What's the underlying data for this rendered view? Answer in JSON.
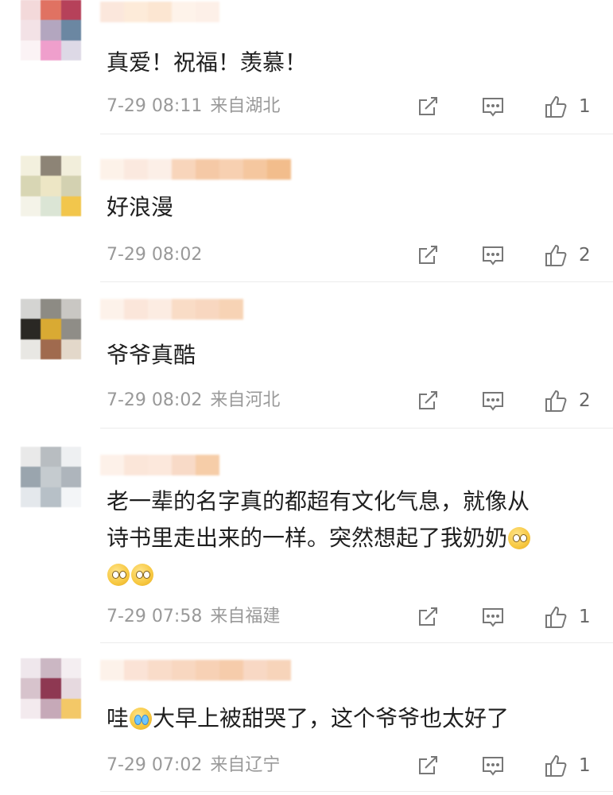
{
  "comments": [
    {
      "text": "真爱！祝福！羡慕！",
      "time": "7-29 08:11",
      "location": "来自湖北",
      "likes": "1"
    },
    {
      "text": "好浪漫",
      "time": "7-29 08:02",
      "location": "",
      "likes": "2"
    },
    {
      "text": "爷爷真酷",
      "time": "7-29 08:02",
      "location": "来自河北",
      "likes": "2"
    },
    {
      "text_line1": "老一辈的名字真的都超有文化气息，就像从",
      "text_line2": "诗书里走出来的一样。突然想起了我奶奶",
      "time": "7-29 07:58",
      "location": "来自福建",
      "likes": "1"
    },
    {
      "text_prefix": "哇",
      "text_suffix": "大早上被甜哭了，这个爷爷也太好了",
      "time": "7-29 07:02",
      "location": "来自辽宁",
      "likes": "1"
    }
  ],
  "icons": {
    "share": "share-icon",
    "reply": "reply-icon",
    "like": "thumbs-up-icon",
    "emoji": "pleading-face-emoji",
    "cry": "crying-face-emoji"
  }
}
